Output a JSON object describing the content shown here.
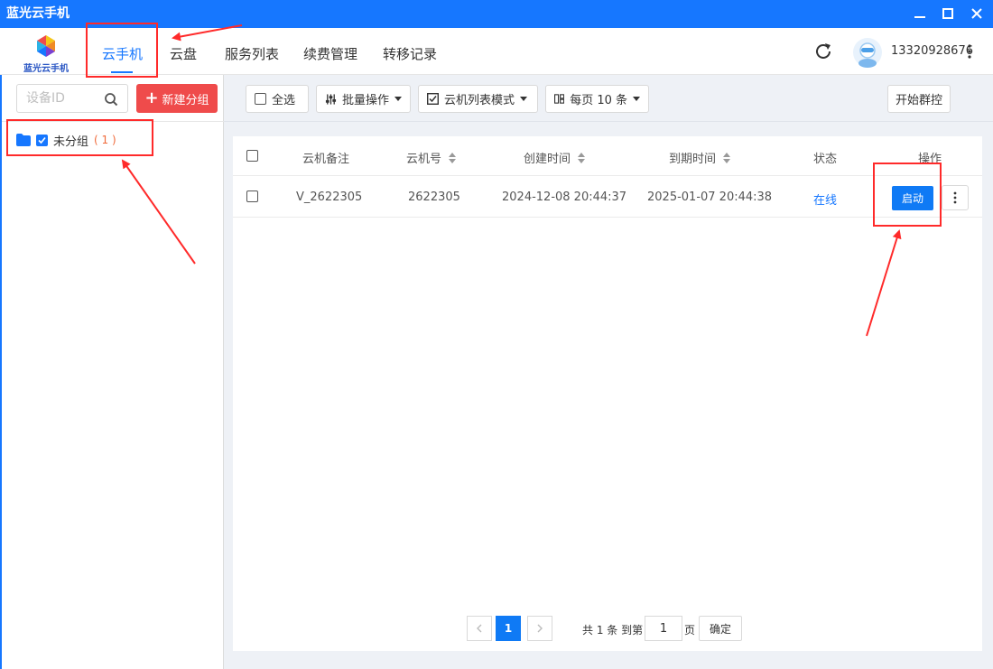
{
  "window": {
    "title": "蓝光云手机"
  },
  "logo": {
    "text": "蓝光云手机"
  },
  "nav": {
    "tabs": [
      {
        "label": "云手机",
        "active": true
      },
      {
        "label": "云盘"
      },
      {
        "label": "服务列表"
      },
      {
        "label": "续费管理"
      },
      {
        "label": "转移记录"
      }
    ],
    "username": "13320928676"
  },
  "sidebar": {
    "search_placeholder": "设备ID",
    "new_group_label": "新建分组",
    "groups": [
      {
        "name": "未分组",
        "count": "( 1 )",
        "checked": true
      }
    ]
  },
  "toolbar": {
    "select_all": "全选",
    "batch_ops": "批量操作",
    "list_mode": "云机列表模式",
    "per_page": "每页 10 条",
    "group_control": "开始群控"
  },
  "table": {
    "headers": [
      "云机备注",
      "云机号",
      "创建时间",
      "到期时间",
      "状态",
      "操作"
    ],
    "rows": [
      {
        "note": "V_2622305",
        "id": "2622305",
        "created": "2024-12-08 20:44:37",
        "expires": "2025-01-07 20:44:38",
        "status": "在线",
        "action": "启动"
      }
    ]
  },
  "pagination": {
    "current": "1",
    "total_text": "共 1 条 到第",
    "goto_value": "1",
    "page_suffix": "页",
    "confirm": "确定"
  },
  "colors": {
    "primary": "#1677ff",
    "danger": "#ef4b4b",
    "annotation": "#ff2a2a"
  }
}
